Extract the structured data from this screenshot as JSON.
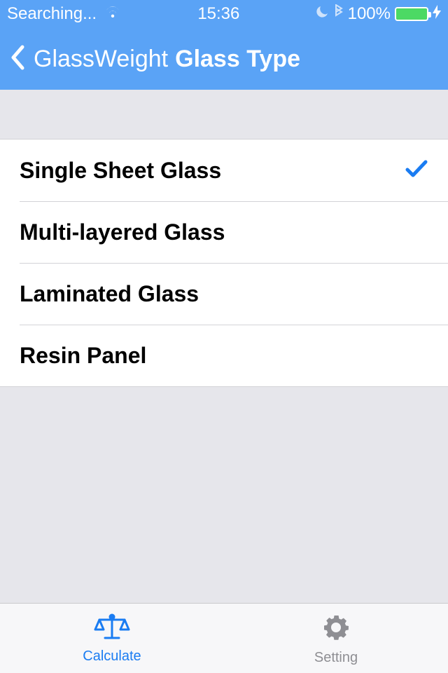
{
  "status": {
    "carrier": "Searching...",
    "time": "15:36",
    "battery_pct": "100%"
  },
  "nav": {
    "back_label": "GlassWeight",
    "title": "Glass Type"
  },
  "options": [
    {
      "label": "Single Sheet Glass",
      "selected": true
    },
    {
      "label": "Multi-layered Glass",
      "selected": false
    },
    {
      "label": "Laminated Glass",
      "selected": false
    },
    {
      "label": "Resin Panel",
      "selected": false
    }
  ],
  "tabs": {
    "calculate": "Calculate",
    "setting": "Setting"
  }
}
